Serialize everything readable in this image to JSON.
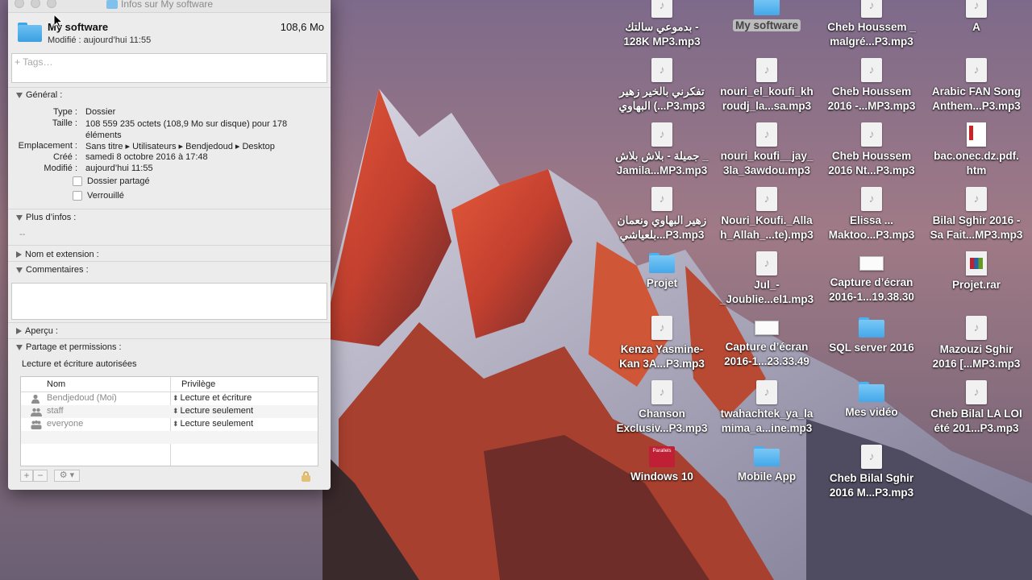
{
  "window": {
    "title": "Infos sur My software",
    "name": "My software",
    "size": "108,6 Mo",
    "modified_line": "Modifié : aujourd’hui 11:55",
    "tags_placeholder": "+ Tags…"
  },
  "general": {
    "header": "Général :",
    "rows": [
      {
        "k": "Type :",
        "v": "Dossier"
      },
      {
        "k": "Taille :",
        "v": "108 559 235 octets (108,9 Mo sur disque) pour 178 éléments"
      },
      {
        "k": "Emplacement :",
        "v": "Sans titre ▸ Utilisateurs ▸ Bendjedoud ▸ Desktop"
      },
      {
        "k": "Créé :",
        "v": "samedi 8 octobre 2016 à 17:48"
      },
      {
        "k": "Modifié :",
        "v": "aujourd’hui 11:55"
      }
    ],
    "shared_folder": "Dossier partagé",
    "locked": "Verrouillé"
  },
  "more_info": {
    "header": "Plus d’infos :",
    "value": "--"
  },
  "name_ext": {
    "header": "Nom et extension :"
  },
  "comments": {
    "header": "Commentaires :"
  },
  "preview": {
    "header": "Aperçu :"
  },
  "sharing": {
    "header": "Partage et permissions :",
    "summary": "Lecture et écriture autorisées",
    "col_name": "Nom",
    "col_priv": "Privilège",
    "rows": [
      {
        "who": "Bendjedoud (Moi)",
        "priv": "Lecture et écriture"
      },
      {
        "who": "staff",
        "priv": "Lecture seulement"
      },
      {
        "who": "everyone",
        "priv": "Lecture seulement"
      }
    ]
  },
  "desktop": [
    {
      "label1": "بدموعي سالتك -",
      "label2": "128K MP3.mp3",
      "kind": "doc"
    },
    {
      "label1": "My software",
      "label2": "",
      "kind": "folder",
      "selected": true
    },
    {
      "label1": "Cheb Houssem _",
      "label2": "malgré...P3.mp3",
      "kind": "doc"
    },
    {
      "label1": "A",
      "label2": "",
      "kind": "doc"
    },
    {
      "label1": "تفكرني بالخير زهير",
      "label2": "البهاوي (...P3.mp3",
      "kind": "doc"
    },
    {
      "label1": "nouri_el_koufi_kh",
      "label2": "roudj_la...sa.mp3",
      "kind": "doc"
    },
    {
      "label1": "Cheb Houssem",
      "label2": "2016 -...MP3.mp3",
      "kind": "doc"
    },
    {
      "label1": "Arabic FAN Song",
      "label2": "Anthem...P3.mp3",
      "kind": "doc"
    },
    {
      "label1": "جميلة - بلاش بلاش _",
      "label2": "Jamila...MP3.mp3",
      "kind": "doc"
    },
    {
      "label1": "nouri_koufi__jay_",
      "label2": "3la_3awdou.mp3",
      "kind": "doc"
    },
    {
      "label1": "Cheb Houssem",
      "label2": "2016 Nt...P3.mp3",
      "kind": "doc"
    },
    {
      "label1": "bac.onec.dz.pdf.",
      "label2": "htm",
      "kind": "htm"
    },
    {
      "label1": "زهير البهاوي ونعمان",
      "label2": "بلعياشي...P3.mp3",
      "kind": "doc"
    },
    {
      "label1": "Nouri_Koufi._Alla",
      "label2": "h_Allah_...te).mp3",
      "kind": "doc"
    },
    {
      "label1": "Elissa ...",
      "label2": "Maktoo...P3.mp3",
      "kind": "doc"
    },
    {
      "label1": "Bilal Sghir 2016 -",
      "label2": "Sa Fait...MP3.mp3",
      "kind": "doc"
    },
    {
      "label1": "Projet",
      "label2": "",
      "kind": "folder"
    },
    {
      "label1": "Jul_-",
      "label2": "_Joublie...el1.mp3",
      "kind": "doc"
    },
    {
      "label1": "Capture d’écran",
      "label2": "2016-1...19.38.30",
      "kind": "shot"
    },
    {
      "label1": "Projet.rar",
      "label2": "",
      "kind": "rar"
    },
    {
      "label1": "Kenza Yasmine-",
      "label2": "Kan 3A...P3.mp3",
      "kind": "doc"
    },
    {
      "label1": "Capture d’écran",
      "label2": "2016-1...23.33.49",
      "kind": "shot"
    },
    {
      "label1": "SQL server 2016",
      "label2": "",
      "kind": "folder"
    },
    {
      "label1": "Mazouzi Sghir",
      "label2": "2016 [...MP3.mp3",
      "kind": "doc"
    },
    {
      "label1": "Chanson",
      "label2": "Exclusiv...P3.mp3",
      "kind": "doc"
    },
    {
      "label1": "twahachtek_ya_la",
      "label2": "mima_a...ine.mp3",
      "kind": "doc"
    },
    {
      "label1": "Mes vidéo",
      "label2": "",
      "kind": "folder"
    },
    {
      "label1": "Cheb Bilal LA LOI",
      "label2": "été 201...P3.mp3",
      "kind": "doc"
    },
    {
      "label1": "Windows 10",
      "label2": "",
      "kind": "win10",
      "badge": "Parallels"
    },
    {
      "label1": "Mobile App",
      "label2": "",
      "kind": "folder"
    },
    {
      "label1": "Cheb Bilal Sghir",
      "label2": "2016 M...P3.mp3",
      "kind": "doc"
    }
  ]
}
